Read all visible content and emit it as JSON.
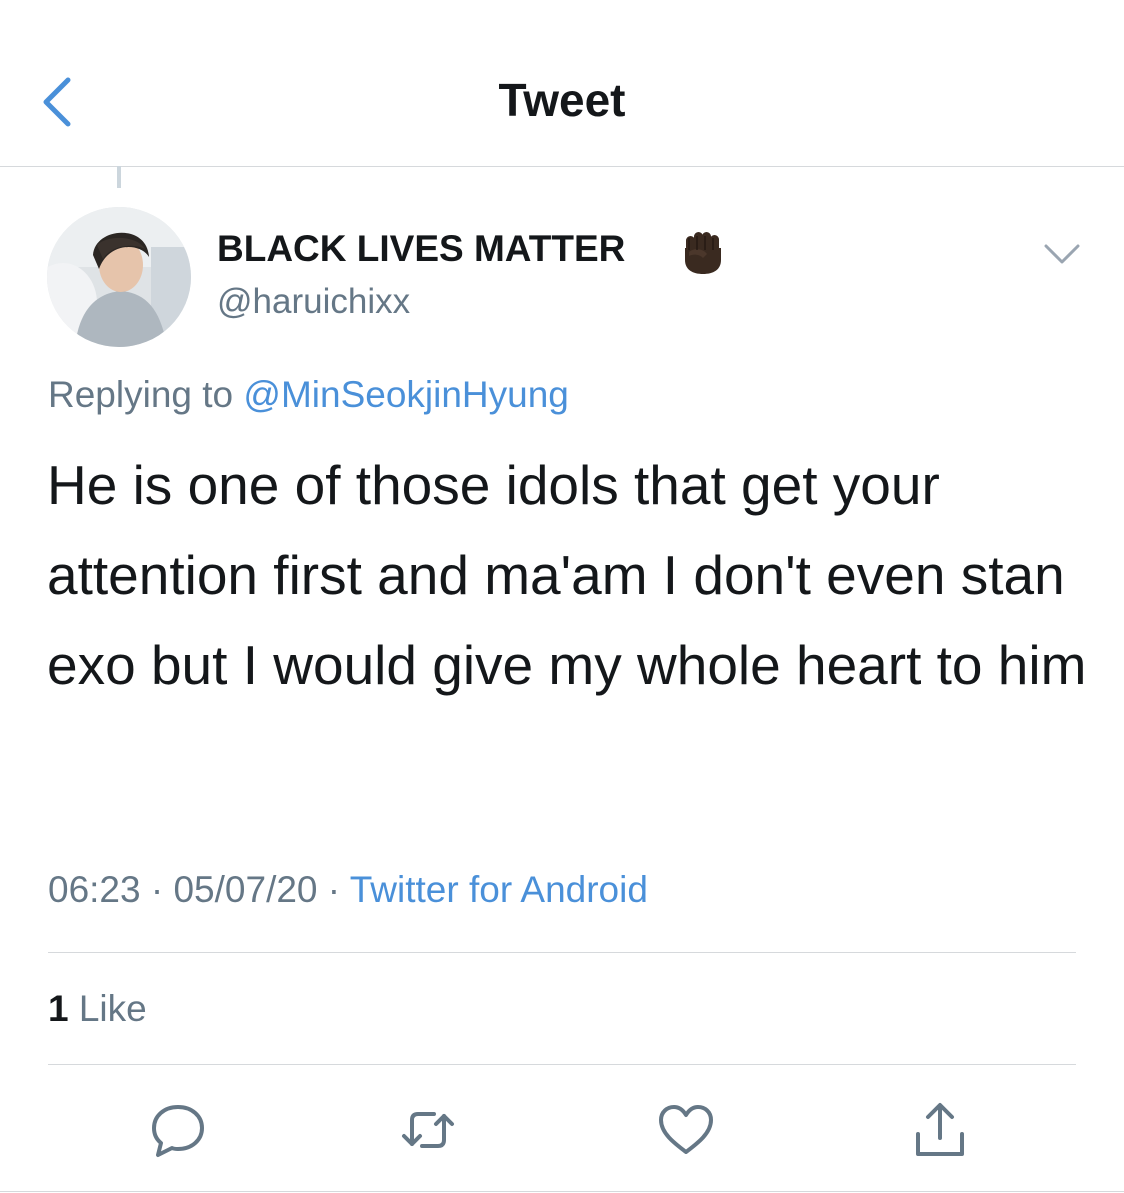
{
  "header": {
    "title": "Tweet",
    "back_icon": "chevron-left-icon"
  },
  "tweet": {
    "display_name": "BLACK LIVES MATTER",
    "display_name_emoji": "raised-fist-dark-skin-emoji",
    "handle": "@haruichixx",
    "replying_prefix": "Replying to",
    "replying_to": "@MinSeokjinHyung",
    "text": "He is one of those idols that get your attention first and ma'am I don't even stan exo but I would give my whole heart to him",
    "time": "06:23",
    "date": "05/07/20",
    "separator": "·",
    "source": "Twitter for Android",
    "likes_count": "1",
    "likes_label": "Like"
  },
  "actions": [
    "reply-icon",
    "retweet-icon",
    "like-icon",
    "share-icon"
  ],
  "colors": {
    "link": "#4a90d9",
    "muted": "#657786",
    "text": "#14171a",
    "divider": "#d6d9dc"
  }
}
